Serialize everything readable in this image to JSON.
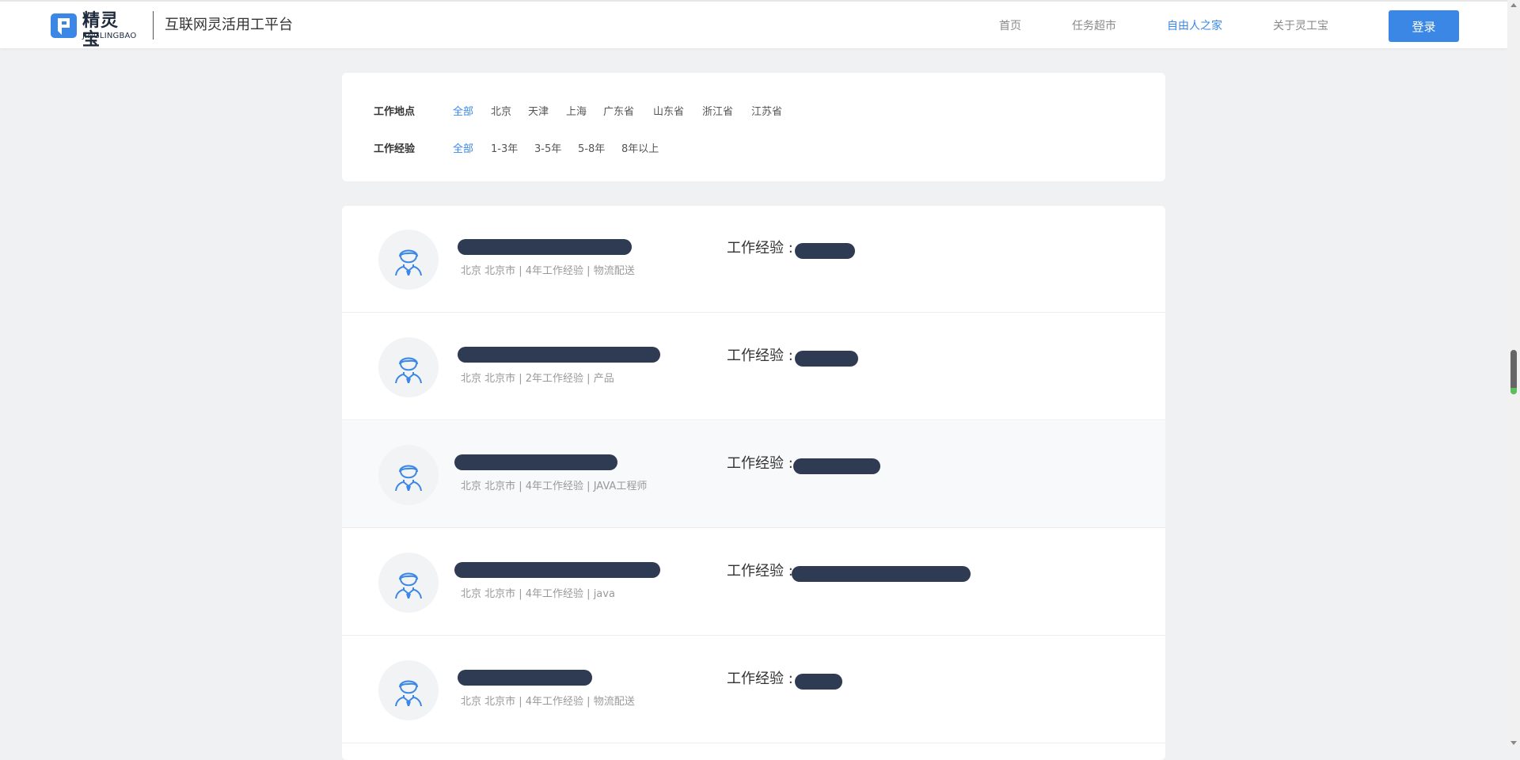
{
  "header": {
    "logo_name": "精灵宝",
    "logo_en": "JINGLINGBAO",
    "platform_name": "互联网灵活用工平台",
    "nav": [
      {
        "label": "首页",
        "active": false
      },
      {
        "label": "任务超市",
        "active": false
      },
      {
        "label": "自由人之家",
        "active": true
      },
      {
        "label": "关于灵工宝",
        "active": false
      }
    ],
    "login_label": "登录"
  },
  "filters": {
    "location": {
      "label": "工作地点",
      "options": [
        "全部",
        "北京",
        "天津",
        "上海",
        "广东省",
        "山东省",
        "浙江省",
        "江苏省"
      ],
      "selected": "全部"
    },
    "experience": {
      "label": "工作经验",
      "options": [
        "全部",
        "1-3年",
        "3-5年",
        "5-8年",
        "8年以上"
      ],
      "selected": "全部"
    }
  },
  "workers": [
    {
      "meta": "北京 北京市 | 4年工作经验 | 物流配送",
      "exp_label": "工作经验 :"
    },
    {
      "meta": "北京 北京市 | 2年工作经验 | 产品",
      "exp_label": "工作经验 :"
    },
    {
      "meta": "北京 北京市 | 4年工作经验 | JAVA工程师",
      "exp_label": "工作经验 :"
    },
    {
      "meta": "北京 北京市 | 4年工作经验 | java",
      "exp_label": "工作经验 :"
    },
    {
      "meta": "北京 北京市 | 4年工作经验 | 物流配送",
      "exp_label": "工作经验 :"
    }
  ],
  "colors": {
    "accent": "#3a87e6",
    "redaction": "#2f3b52",
    "page_bg": "#f0f1f3"
  }
}
